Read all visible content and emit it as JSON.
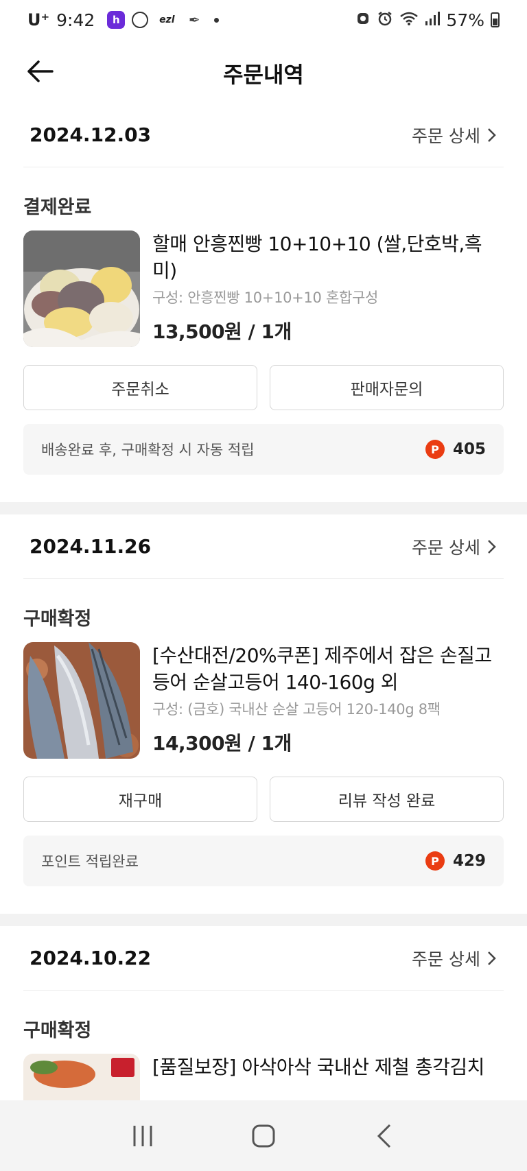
{
  "status_bar": {
    "carrier": "U⁺",
    "time": "9:42",
    "app_icons": [
      "h",
      "",
      "ezl",
      "✒"
    ],
    "battery": "57%"
  },
  "header": {
    "title": "주문내역",
    "back_icon": "back-arrow-icon"
  },
  "orders": [
    {
      "date": "2024.12.03",
      "detail_link": "주문 상세",
      "status": "결제완료",
      "product_name": "할매 안흥찐빵 10+10+10 (쌀,단호박,흑미)",
      "option": "구성: 안흥찐빵 10+10+10 혼합구성",
      "price": "13,500원 / 1개",
      "buttons": [
        "주문취소",
        "판매자문의"
      ],
      "points_text": "배송완료 후, 구매확정 시 자동 적립",
      "points_badge": "P",
      "points_value": "405"
    },
    {
      "date": "2024.11.26",
      "detail_link": "주문 상세",
      "status": "구매확정",
      "product_name": "[수산대전/20%쿠폰] 제주에서 잡은 손질고등어 순살고등어 140-160g 외",
      "option": "구성: (금호) 국내산 순살 고등어 120-140g 8팩",
      "price": "14,300원 / 1개",
      "buttons": [
        "재구매",
        "리뷰 작성 완료"
      ],
      "points_text": "포인트 적립완료",
      "points_badge": "P",
      "points_value": "429"
    },
    {
      "date": "2024.10.22",
      "detail_link": "주문 상세",
      "status": "구매확정",
      "product_name": "[품질보장] 아삭아삭 국내산 제철 총각김치"
    }
  ],
  "nav": {
    "recent_icon": "recent-apps-icon",
    "home_icon": "home-icon",
    "back_icon": "nav-back-icon"
  },
  "colors": {
    "accent_points": "#ea3c12",
    "divider": "#f2f2f2",
    "points_bg": "#f6f6f6"
  }
}
